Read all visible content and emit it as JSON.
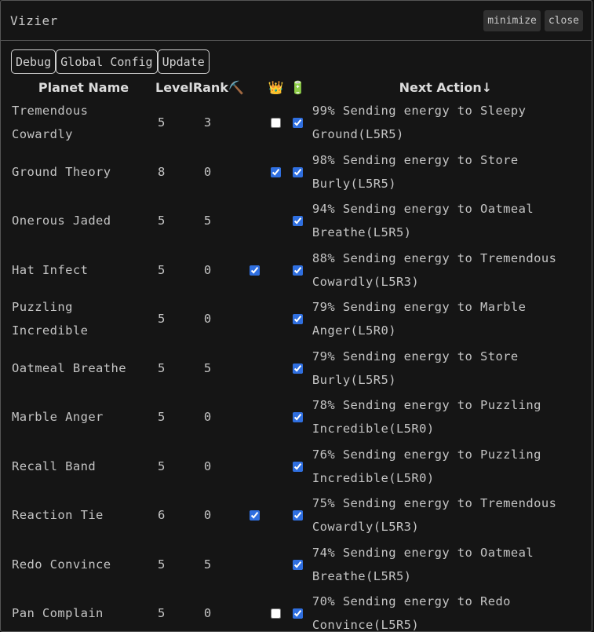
{
  "window": {
    "title": "Vizier",
    "minimize_label": "minimize",
    "close_label": "close"
  },
  "toolbar": {
    "debug_label": "Debug",
    "global_config_label": "Global Config",
    "update_label": "Update"
  },
  "table": {
    "headers": {
      "name": "Planet Name",
      "level": "Level",
      "rank": "Rank",
      "mine_icon": "⛏️",
      "crown_icon": "👑",
      "battery_icon": "🔋",
      "action": "Next Action↓"
    },
    "rows": [
      {
        "name": "Tremendous Cowardly",
        "level": "5",
        "rank": "3",
        "mine": null,
        "crown": false,
        "battery": true,
        "action": "99% Sending energy to Sleepy Ground(L5R5)"
      },
      {
        "name": "Ground Theory",
        "level": "8",
        "rank": "0",
        "mine": null,
        "crown": true,
        "battery": true,
        "action": "98% Sending energy to Store Burly(L5R5)"
      },
      {
        "name": "Onerous Jaded",
        "level": "5",
        "rank": "5",
        "mine": null,
        "crown": null,
        "battery": true,
        "action": "94% Sending energy to Oatmeal Breathe(L5R5)"
      },
      {
        "name": "Hat Infect",
        "level": "5",
        "rank": "0",
        "mine": true,
        "crown": null,
        "battery": true,
        "action": "88% Sending energy to Tremendous Cowardly(L5R3)"
      },
      {
        "name": "Puzzling Incredible",
        "level": "5",
        "rank": "0",
        "mine": null,
        "crown": null,
        "battery": true,
        "action": "79% Sending energy to Marble Anger(L5R0)"
      },
      {
        "name": "Oatmeal Breathe",
        "level": "5",
        "rank": "5",
        "mine": null,
        "crown": null,
        "battery": true,
        "action": "79% Sending energy to Store Burly(L5R5)"
      },
      {
        "name": "Marble Anger",
        "level": "5",
        "rank": "0",
        "mine": null,
        "crown": null,
        "battery": true,
        "action": "78% Sending energy to Puzzling Incredible(L5R0)"
      },
      {
        "name": "Recall Band",
        "level": "5",
        "rank": "0",
        "mine": null,
        "crown": null,
        "battery": true,
        "action": "76% Sending energy to Puzzling Incredible(L5R0)"
      },
      {
        "name": "Reaction Tie",
        "level": "6",
        "rank": "0",
        "mine": true,
        "crown": null,
        "battery": true,
        "action": "75% Sending energy to Tremendous Cowardly(L5R3)"
      },
      {
        "name": "Redo Convince",
        "level": "5",
        "rank": "5",
        "mine": null,
        "crown": null,
        "battery": true,
        "action": "74% Sending energy to Oatmeal Breathe(L5R5)"
      },
      {
        "name": "Pan Complain",
        "level": "5",
        "rank": "0",
        "mine": null,
        "crown": false,
        "battery": true,
        "action": "70% Sending energy to Redo Convince(L5R5)"
      }
    ]
  },
  "colors": {
    "background": "#151515",
    "checkbox_accent": "#2f6fe0",
    "border": "#555555"
  }
}
